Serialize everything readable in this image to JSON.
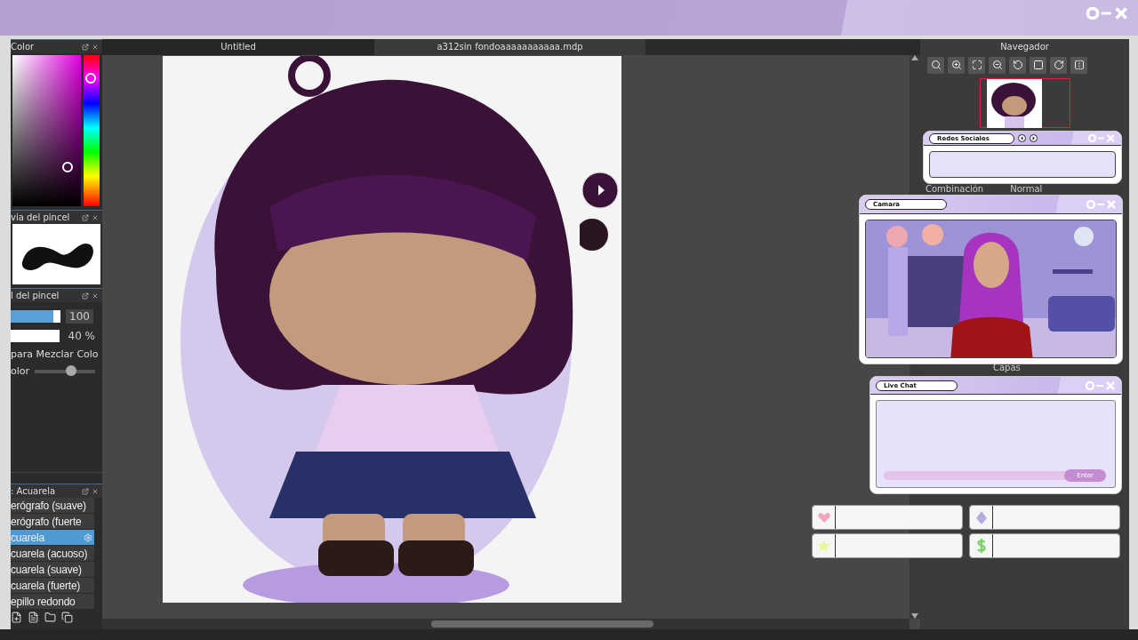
{
  "tabs": [
    {
      "label": "Untitled",
      "selected": false
    },
    {
      "label": "a312sin fondoaaaaaaaaaaa.mdp",
      "selected": true
    }
  ],
  "color_panel": {
    "title": "Color"
  },
  "brush_preview_panel": {
    "title": "via del pincel"
  },
  "brush_control_panel": {
    "title": "l del pincel",
    "size": {
      "level": 0.85,
      "value": "100"
    },
    "opacity": {
      "level": 1,
      "value": "40 %"
    },
    "mix_label": "para Mezclar Colo",
    "mix_slider": {
      "label": "olor",
      "level": 0.6
    }
  },
  "brush_panel": {
    "title": ": Acuarela",
    "items": [
      {
        "label": "erógrafo (suave)",
        "selected": false
      },
      {
        "label": "erógrafo (fuerte",
        "selected": false
      },
      {
        "label": "cuarela",
        "selected": true
      },
      {
        "label": "cuarela (acuoso)",
        "selected": false
      },
      {
        "label": "cuarela (suave)",
        "selected": false
      },
      {
        "label": "cuarela (fuerte)",
        "selected": false
      },
      {
        "label": "epillo redondo",
        "selected": false
      }
    ]
  },
  "navigator": {
    "title": "Navegador"
  },
  "layers": {
    "blend_label": "Combinación",
    "blend_value": "Normal",
    "title": "Capas"
  },
  "overlays": {
    "social": {
      "title": "Redes Sociales"
    },
    "camera": {
      "title": "Camara"
    },
    "chat": {
      "title": "Live Chat",
      "button": "Enter"
    },
    "stats": [
      {
        "kind": "heart"
      },
      {
        "kind": "diamond"
      },
      {
        "kind": "star"
      },
      {
        "kind": "dollar"
      }
    ]
  }
}
